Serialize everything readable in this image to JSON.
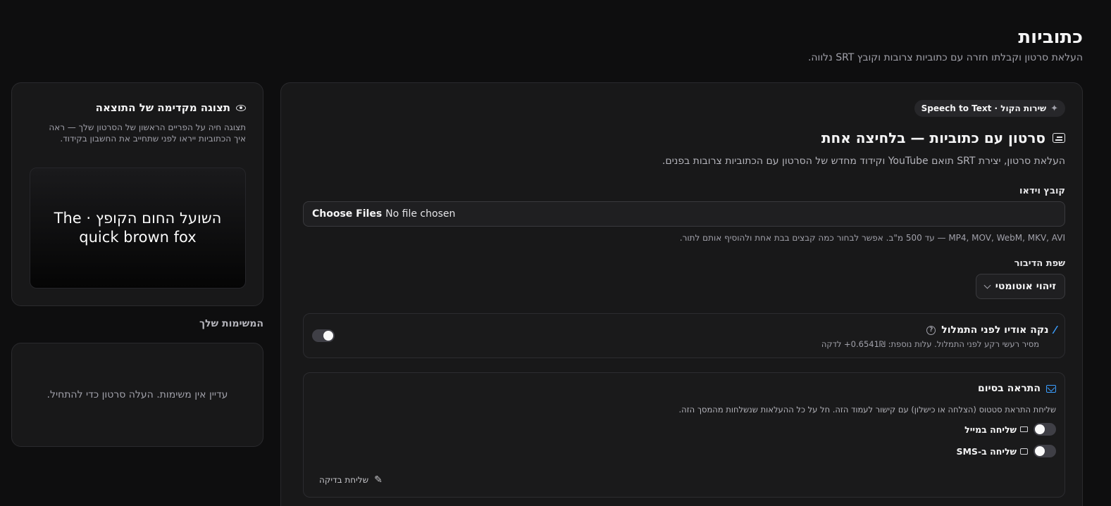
{
  "header": {
    "title": "כתוביות",
    "subtitle": "העלאת סרטון וקבלתו חזרה עם כתוביות צרובות וקובץ SRT נלווה."
  },
  "main": {
    "service_pill": "שירות הקול · Speech to Text",
    "title": "סרטון עם כתוביות — בלחיצה אחת",
    "description": "העלאת סרטון, יצירת SRT תואם YouTube וקידוד מחדש של הסרטון עם הכתוביות צרובות בפנים.",
    "video_label": "קובץ וידאו",
    "file_button": "Choose Files",
    "file_status": "No file chosen",
    "file_hint": "MP4, MOV, WebM, MKV, AVI — עד 500 מ\"ב. אפשר לבחור כמה קבצים בבת אחת ולהוסיף אותם לתור.",
    "language_label": "שפת הדיבור",
    "language_value": "זיהוי אוטומטי",
    "clean_audio": {
      "title": "נקה אודיו לפני התמלול",
      "description": "מסיר רעשי רקע לפני התמלול. עלות נוספת: 0.6541₪+ לדקה",
      "enabled": true
    },
    "notify": {
      "title": "התראה בסיום",
      "description": "שליחת התראת סטטוס (הצלחה או כישלון) עם קישור לעמוד הזה. חל על כל ההעלאות שנשלחות מהמסך הזה.",
      "email_label": "שליחה במייל",
      "sms_label": "שליחה ב-SMS",
      "email_enabled": false,
      "sms_enabled": false,
      "test_button": "שליחת בדיקה"
    }
  },
  "preview": {
    "title": "תצוגה מקדימה של התוצאה",
    "description": "תצוגה חיה על הפריים הראשון של הסרטון שלך — ראה איך הכתוביות ייראו לפני שתחייב את החשבון בקידוד.",
    "caption": "השועל החום הקופץ · The quick brown fox"
  },
  "tasks": {
    "heading": "המשימות שלך",
    "empty": "עדיין אין משימות. העלה סרטון כדי להתחיל."
  },
  "colors": {
    "background": "#0e0e0f",
    "card": "#181819",
    "accent": "#3b9eff"
  }
}
